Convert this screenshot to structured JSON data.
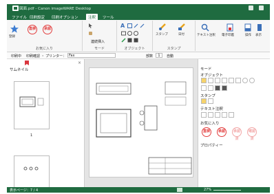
{
  "titlebar": {
    "title": "図面.pdf - Canon imageWARE Desktop"
  },
  "tabs": [
    "ファイル",
    "印刷設定",
    "印刷オプション",
    "注釈",
    "ツール"
  ],
  "ribbon": {
    "fav_label": "お気に入り",
    "fav_big": "登録",
    "stamp1": "直検",
    "stamp2": "承認",
    "mode_label": "モード",
    "mode_btn": "連続挿入",
    "object_label": "オブジェクト",
    "stamp_group_label": "スタンプ",
    "stamp_btn": "スタンプ",
    "date_btn": "日付",
    "text_btn": "テキスト注釈",
    "edit_btn": "電子印鑑",
    "op_btn": "操作",
    "view_btn": "表示"
  },
  "quick": {
    "print": "印刷中",
    "printer_label": "印刷確認 ・ プリンター：",
    "printer": "Fax",
    "page_label": "部数",
    "page_value": "1",
    "paper": "自動"
  },
  "thumbs": {
    "title": "サムネイル",
    "page1": "1"
  },
  "props": {
    "mode": "モード",
    "object": "オブジェクト",
    "stamp": "スタンプ",
    "textnote": "テキスト注釈",
    "favorites": "お気に入り",
    "property": "プロパティー",
    "stamp_a": "直検",
    "stamp_b": "承認",
    "stamp_c": "承認済",
    "stamp_d": "確認済"
  },
  "status": {
    "page": "表示ページ：7 / 4",
    "zoom": "27%"
  }
}
